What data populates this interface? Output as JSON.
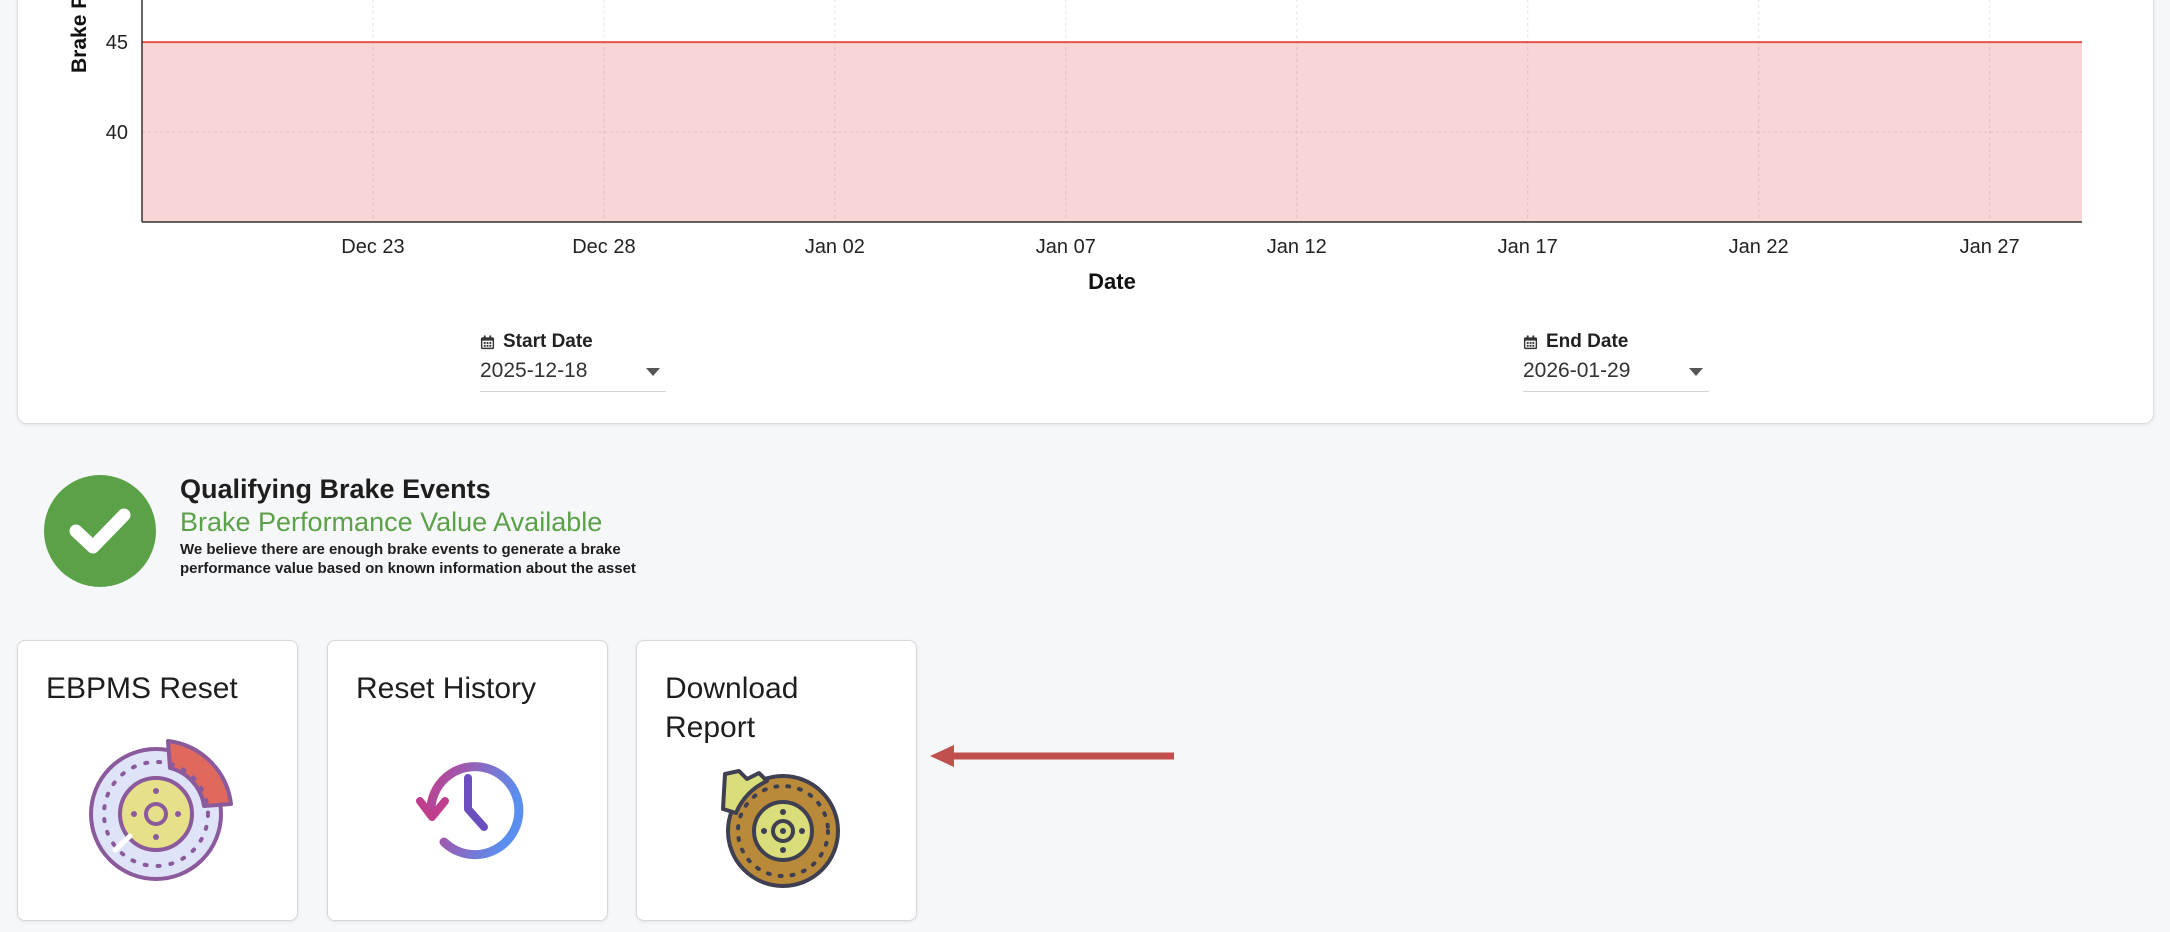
{
  "chart_data": {
    "type": "area",
    "x": [
      "2025-12-18",
      "2026-01-29"
    ],
    "series": [
      {
        "values": [
          45,
          45
        ],
        "color": "#e8534f",
        "fill": "#f8d6d6"
      }
    ],
    "y_ticks": [
      40,
      45
    ],
    "ylabel": "Brake P",
    "xlabel": "Date",
    "x_tick_labels": [
      "Dec 23",
      "Dec 28",
      "Jan 02",
      "Jan 07",
      "Jan 12",
      "Jan 17",
      "Jan 22",
      "Jan 27"
    ],
    "x_tick_dates": [
      "2025-12-23",
      "2025-12-28",
      "2026-01-02",
      "2026-01-07",
      "2026-01-12",
      "2026-01-17",
      "2026-01-22",
      "2026-01-27"
    ],
    "ylim": [
      35,
      48.4
    ],
    "grid": true
  },
  "date_range": {
    "start": {
      "label": "Start Date",
      "value": "2025-12-18"
    },
    "end": {
      "label": "End Date",
      "value": "2026-01-29"
    }
  },
  "status": {
    "title": "Qualifying Brake Events",
    "subtitle": "Brake Performance Value Available",
    "description": "We believe there are enough brake events to generate a brake performance value based on known information about the asset",
    "color": "#5aa148",
    "icon": "checkmark-icon"
  },
  "tiles": [
    {
      "title": "EBPMS Reset",
      "icon": "brake-caliper-icon"
    },
    {
      "title": "Reset History",
      "icon": "history-clock-icon"
    },
    {
      "title": "Download Report",
      "icon": "brake-disc-report-icon"
    }
  ],
  "annotation": {
    "color": "#c0504d",
    "icon": "left-arrow-icon"
  }
}
